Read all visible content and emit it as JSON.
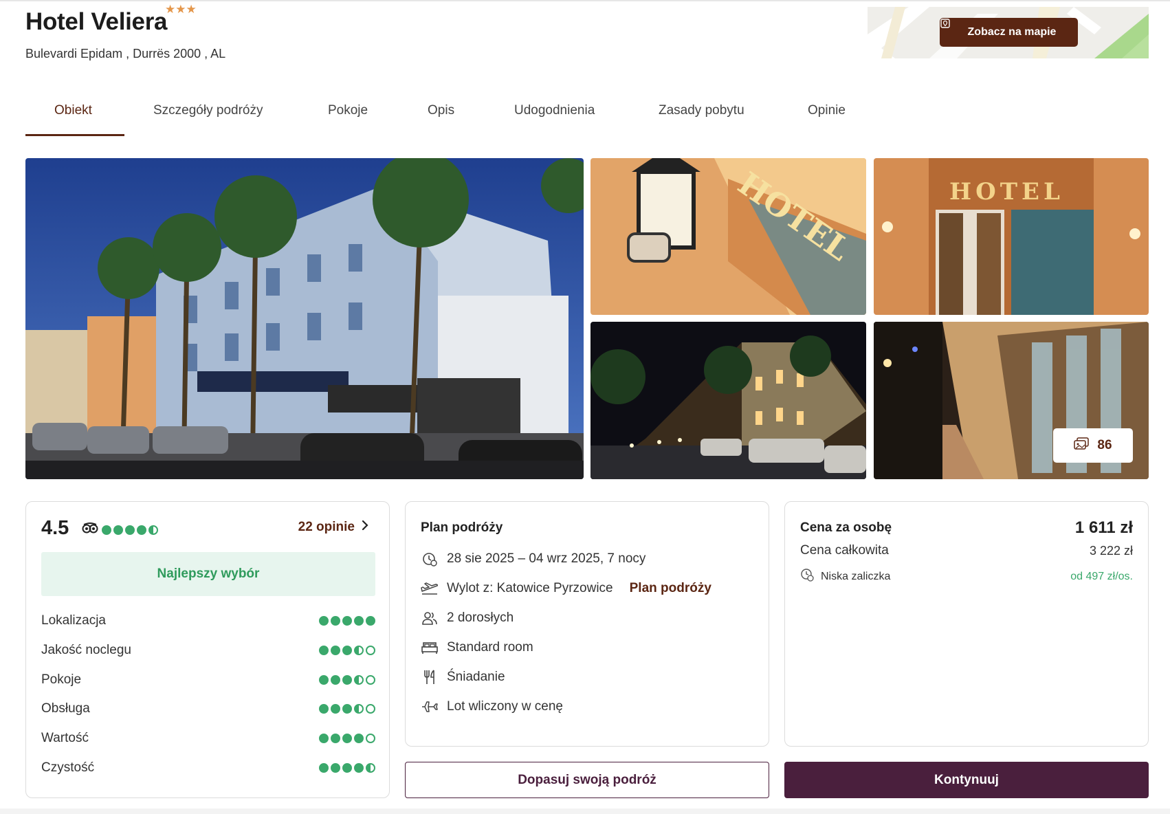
{
  "hotel": {
    "name": "Hotel Veliera",
    "stars": "★★★",
    "address": "Bulevardi Epidam , Durrës 2000 , AL"
  },
  "map": {
    "button_label": "Zobacz na mapie",
    "icon": "map-pin-icon"
  },
  "tabs": [
    {
      "label": "Obiekt",
      "active": true
    },
    {
      "label": "Szczegóły podróży",
      "active": false
    },
    {
      "label": "Pokoje",
      "active": false
    },
    {
      "label": "Opis",
      "active": false
    },
    {
      "label": "Udogodnienia",
      "active": false
    },
    {
      "label": "Zasady pobytu",
      "active": false
    },
    {
      "label": "Opinie",
      "active": false
    }
  ],
  "gallery": {
    "photo_count": "86",
    "icon": "photos-icon"
  },
  "rating": {
    "score": "4.5",
    "source_icon": "tripadvisor-owl-icon",
    "overall_dots": 4.5,
    "reviews_link": "22 opinie",
    "badge": "Najlepszy wybór",
    "categories": [
      {
        "label": "Lokalizacja",
        "dots": 5
      },
      {
        "label": "Jakość noclegu",
        "dots": 3.5
      },
      {
        "label": "Pokoje",
        "dots": 3.5
      },
      {
        "label": "Obsługa",
        "dots": 3.5
      },
      {
        "label": "Wartość",
        "dots": 4
      },
      {
        "label": "Czystość",
        "dots": 4.5
      }
    ]
  },
  "plan": {
    "title": "Plan podróży",
    "dates": "28 sie 2025 – 04 wrz 2025, 7 nocy",
    "departure": "Wylot z: Katowice Pyrzowice",
    "departure_link": "Plan podróży",
    "guests": "2 dorosłych",
    "room": "Standard room",
    "board": "Śniadanie",
    "flight": "Lot wliczony w cenę"
  },
  "price": {
    "per_person_label": "Cena za osobę",
    "per_person_value": "1 611 zł",
    "total_label": "Cena całkowita",
    "total_value": "3 222 zł",
    "deposit_label": "Niska zaliczka",
    "deposit_value": "od 497 zł/os.",
    "accent_green": "#3aa86b"
  },
  "actions": {
    "customize_label": "Dopasuj swoją podróż",
    "continue_label": "Kontynuuj"
  },
  "colors": {
    "brand_brown": "#5b2613",
    "brand_plum": "#4a1f3d",
    "star": "#e4964a",
    "green": "#3aa86b"
  }
}
